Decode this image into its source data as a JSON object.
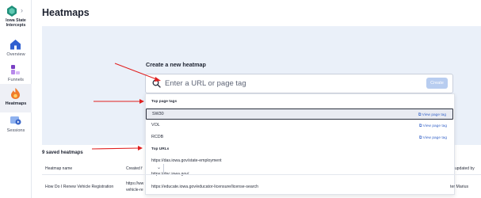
{
  "sidebar": {
    "org_name": "Iowa State Intercepts",
    "expand_icon": "chevron-right-icon",
    "items": [
      {
        "label": "Overview",
        "icon": "home-icon"
      },
      {
        "label": "Funnels",
        "icon": "funnel-icon"
      },
      {
        "label": "Heatmaps",
        "icon": "flame-icon",
        "active": true
      },
      {
        "label": "Sessions",
        "icon": "sessions-icon"
      }
    ]
  },
  "page": {
    "title": "Heatmaps"
  },
  "create": {
    "label": "Create a new heatmap",
    "placeholder": "Enter a URL or page tag",
    "button": "Create"
  },
  "dropdown": {
    "page_tags_title": "Top page tags",
    "page_tags": [
      {
        "name": "SW30",
        "link": "View page tag"
      },
      {
        "name": "VOL",
        "link": "View page tag"
      },
      {
        "name": "RCDB",
        "link": "View page tag"
      }
    ],
    "urls_title": "Top URLs",
    "urls": [
      "https://das.iowa.gov/state-employment",
      "https://dnc.iowa.gov/",
      "https://educate.iowa.gov/educator-licensure/license-search"
    ]
  },
  "saved": {
    "title": "9 saved heatmaps",
    "columns": [
      "Heatmap name",
      "Created f",
      "updated by"
    ],
    "row": {
      "name": "How Do I Renew Vehicle Registration",
      "url_line1": "https://ww",
      "url_line2": "vehicle-re",
      "updated_by": "ter Marius"
    }
  },
  "colors": {
    "accent": "#3b67c9",
    "hero_bg": "#eaf0f9",
    "annotation_arrow": "#e02020",
    "create_button_disabled": "#b8cdf0"
  }
}
